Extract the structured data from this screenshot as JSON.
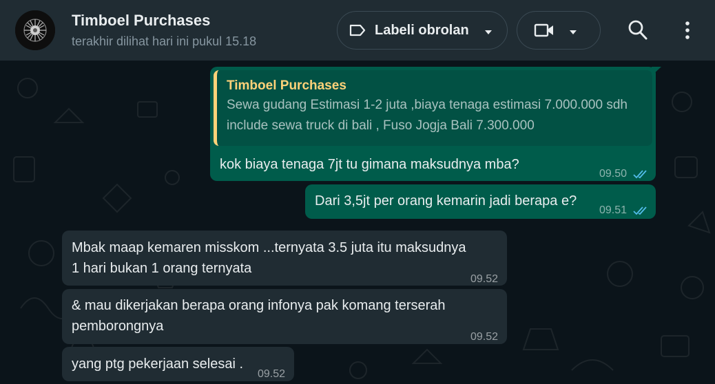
{
  "header": {
    "title": "Timboel Purchases",
    "subtitle": "terakhir dilihat hari ini pukul 15.18",
    "label_button": "Labeli obrolan",
    "icons": [
      "label-icon",
      "chevron-down-icon",
      "video-call-icon",
      "search-icon",
      "more-vertical-icon"
    ]
  },
  "messages": [
    {
      "direction": "out",
      "quote_author": "Timboel Purchases",
      "quote_text_1": "Sewa gudang Estimasi 1-2 juta ,biaya tenaga estimasi 7.000.000 sdh",
      "quote_text_2": "include sewa truck di bali , Fuso Jogja Bali 7.300.000",
      "text": "kok biaya tenaga 7jt tu gimana maksudnya mba?",
      "time": "09.50",
      "status": "read"
    },
    {
      "direction": "out",
      "text": "Dari 3,5jt per orang kemarin jadi berapa e?",
      "time": "09.51",
      "status": "read"
    },
    {
      "direction": "in",
      "text_1": "Mbak maap kemaren misskom ...ternyata 3.5 juta itu maksudnya",
      "text_2": "1 hari bukan 1 orang ternyata",
      "time": "09.52"
    },
    {
      "direction": "in",
      "text_1": "& mau dikerjakan berapa orang infonya pak komang terserah",
      "text_2": "pemborongnya",
      "time": "09.52"
    },
    {
      "direction": "in",
      "text": "yang ptg pekerjaan selesai .",
      "time": "09.52"
    }
  ],
  "colors": {
    "outgoing_bubble": "#005c4b",
    "incoming_bubble": "#202c33",
    "quote_accent": "#ffd279",
    "read_ticks": "#53bdeb"
  }
}
